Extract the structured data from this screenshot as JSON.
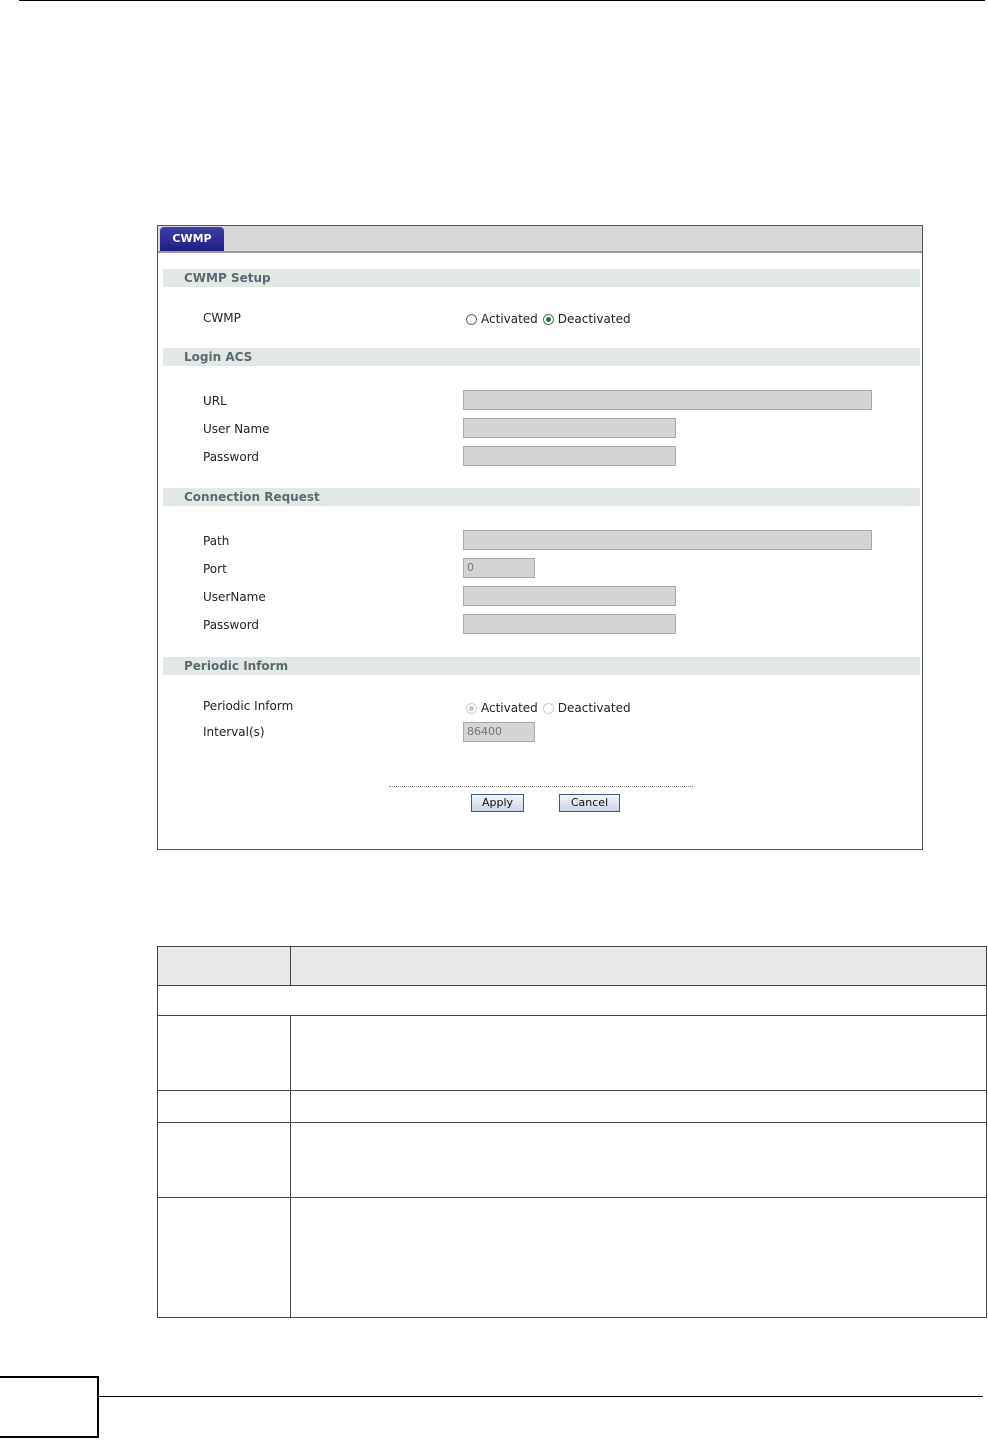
{
  "panel": {
    "tab": "CWMP",
    "sections": {
      "cwmp_setup": "CWMP Setup",
      "login_acs": "Login ACS",
      "connection_request": "Connection Request",
      "periodic_inform": "Periodic Inform"
    },
    "cwmp": {
      "label": "CWMP",
      "activated": "Activated",
      "deactivated": "Deactivated",
      "selected": "Deactivated"
    },
    "login_acs": {
      "url_label": "URL",
      "url_value": "",
      "username_label": "User Name",
      "username_value": "",
      "password_label": "Password",
      "password_value": ""
    },
    "connection_request": {
      "path_label": "Path",
      "path_value": "",
      "port_label": "Port",
      "port_value": "0",
      "username_label": "UserName",
      "username_value": "",
      "password_label": "Password",
      "password_value": ""
    },
    "periodic_inform": {
      "label": "Periodic Inform",
      "activated": "Activated",
      "deactivated": "Deactivated",
      "selected": "Activated",
      "interval_label": "Interval(s)",
      "interval_value": "86400"
    },
    "buttons": {
      "apply": "Apply",
      "cancel": "Cancel"
    }
  }
}
